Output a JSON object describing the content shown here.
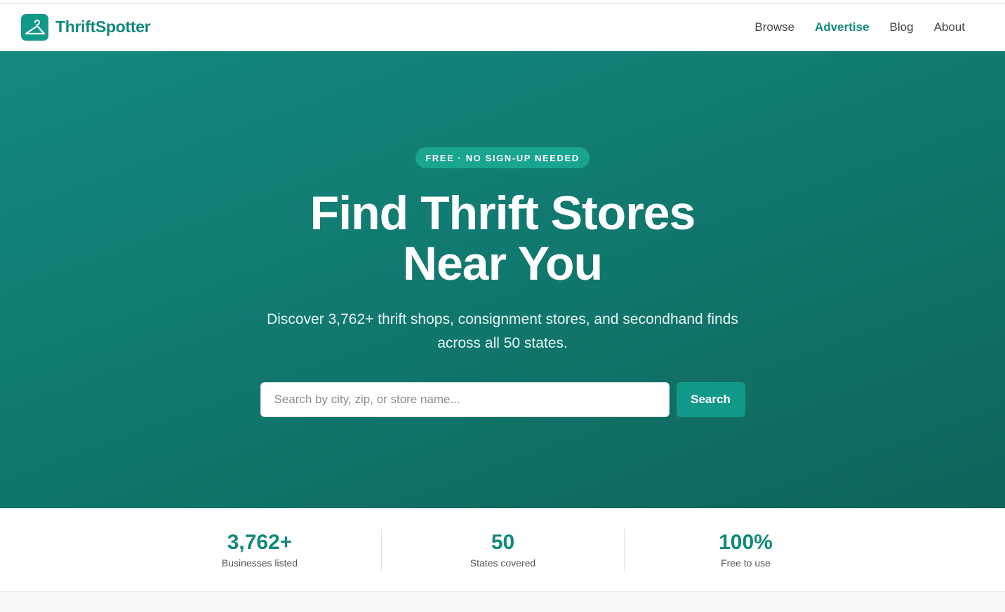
{
  "brand": {
    "name": "ThriftSpotter",
    "accent": "#11897c",
    "logo_icon": "hanger-icon"
  },
  "nav": {
    "links": [
      {
        "label": "Browse",
        "active": false
      },
      {
        "label": "Advertise",
        "active": true
      },
      {
        "label": "Blog",
        "active": false
      },
      {
        "label": "About",
        "active": false
      }
    ]
  },
  "hero": {
    "badge": "FREE · NO SIGN-UP NEEDED",
    "title_line1": "Find Thrift Stores",
    "title_line2": "Near You",
    "subtitle": "Discover 3,762+ thrift shops, consignment stores, and secondhand finds across all 50 states.",
    "search": {
      "placeholder": "Search by city, zip, or store name...",
      "value": "",
      "button_label": "Search"
    },
    "gradient": [
      "#13897f",
      "#0f6459"
    ]
  },
  "stats": [
    {
      "value": "3,762+",
      "label": "Businesses listed"
    },
    {
      "value": "50",
      "label": "States covered"
    },
    {
      "value": "100%",
      "label": "Free to use"
    }
  ]
}
